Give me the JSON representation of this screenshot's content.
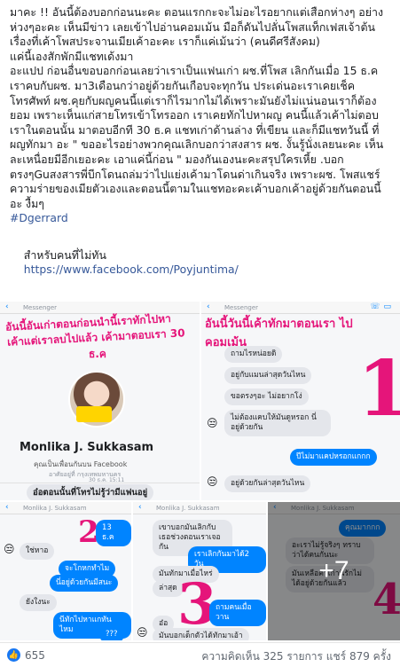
{
  "post": {
    "paragraph1": "มาคะ !! อันนี้ต้องบอกก่อนนะคะ ตอนแรกกะจะไม่อะไรอยากแต่เสือกห่างๆ อย่างห่วงๆอะคะ เห็นมีข่าว เลยเข้าไปอ่านคอมเม้น มือก็ดันไปลั่นโพสแท็กเฟสเจ้าต้นเรื่องที่เค้าโพสประจานเมียเค้าอะคะ เราก็แค่เม้นว่า (คนดีศรีสังคม)",
    "paragraph2": "แค่นี้เองสักพักมีแชทเด้งมา",
    "paragraph3": "อะแปป ก่อนอื่นขอบอกก่อนเลยว่าเราเป็นแฟนเก่า ผช.ที่โพส เลิกกันเมื่อ 15 ธ.ค เราคบกับผช. มา3เดือนกว่าอยู่ด้วยกันเกือบจะทุกวัน ประเด่นอะเราเคยเช็คโทรศัพท์ ผช.คุยกับผญคนนี้แต่เราก็ไรมากไม่ได้เพราะมันยังไม่แน่นอนเราก็ต้องยอม เพราะเห็นแก่สายโทรเข้าโทรออก เราเคยทักไปหาผญ คนนี้แล้วเค้าไม่ตอบเราในตอนนั้น มาตอบอีกที 30 ธ.ค แชทเก่าด้านล่าง ที่เขียน และก็มีแชทวันนี้ ที่ผญทักมา อะ \" ขออะไรอย่างพวกคุณเลิกบอกว่าสงสาร ผช. งั้นรู้นั่งเลยนะคะ เห็นละเหนื่อยมีอีกเยอะคะ เอาแค่นี้ก่อน \" มองกันเองนะคะสรุปใครเหี้ย .บอกตรงๆGuสงสารพี่บีกโดนถล่มว่าไปแย่งเค้ามาโดนด่าเกินจริง เพราะผช. โพสแชร์ความร่ายของเมียตัวเองและตอนนี้ตามในแชทอะคะเค้าบอกเค้าอยู่ด้วยกันตอนนี้ อะ งื้มๆ",
    "hashtag": "#Dgerrard",
    "link_label": "สำหรับคนที่ไม่ทัน",
    "link_url": "https://www.facebook.com/Poyjuntima/"
  },
  "images": {
    "top_left": {
      "header": "Messenger",
      "annotation_line1": "อันนี้อันเก่าตอนก่อนนำนี้เราทักไปหา",
      "annotation_line2": "เค้าแต่เราลบไปแล้ว เค้ามาตอบเรา 30",
      "annotation_line3": "ธ.ค",
      "profile_name": "Monlika J. Sukkasam",
      "profile_sub": "คุณเป็นเพื่อนกันบน Facebook",
      "profile_sub2": "อาศัยอยู่ที่ กรุงเทพมหานคร",
      "time": "30 ธ.ค. 15:11",
      "caption": "อ๋อตอนนั้นที่โทรไม่รู้ว่ามีแฟนอยู่"
    },
    "top_right": {
      "header": "Messenger",
      "annotation": "อันนี้วันนี้เค้าทักมาตอนเรา ไปคอมเม้น",
      "number": "1",
      "msg1": "ถามไรหน่อยดิ",
      "msg2": "อยู่กับแมนล่าสุดวันไหน",
      "msg3": "ขอตรงๆอะ ไม่อยากโง่",
      "msg4": "ไม่ต้องแคบให้มันดูหรอก นี่อยู่ด้วยกัน",
      "reply1": "ปีไม่มาแคปหรอกแกกก",
      "msg5": "อยู่ด้วยกันล่าสุดวันไหน"
    },
    "bottom1": {
      "header": "Monlika J. Sukkasam",
      "number": "2",
      "reply": "13 ธ.ค",
      "msg1": "ใช่หาอ",
      "reply2": "จะโกหกทำไม",
      "reply3": "นี่อยู่ด้วยกันมีสนะ",
      "msg2": "ยังใงนะ",
      "reply4": "นีทักไปหาแกทันไหม",
      "reply5": "???"
    },
    "bottom2": {
      "header": "Monlika J. Sukkasam",
      "number": "3",
      "msg1": "เขาบอกมันเลิกกับเธอช่วงตอนเราเจอกัน",
      "reply1": "เราเลิกกันมาได้2 วัน",
      "msg2": "มันทักมาเมื่อไหร่",
      "msg3": "ล่าสุด",
      "reply2": "ถามคนเมื่อวาน",
      "msg4": "อ๋อ",
      "msg5": "มันบอกเด็กตัวได้ทักมาเอ้า"
    },
    "bottom3": {
      "header": "Monlika J. Sukkasam",
      "number": "4",
      "more_count": "+7",
      "reply1": "คุณมากกก",
      "msg1": "อะเราไม่รู้จริงๆ ทราบว่าได้คนกันนะ",
      "msg2": "มันเหลือคำเก้านี่รักไม่ได้อยู่ด้วยกันแล้ว"
    }
  },
  "footer": {
    "like_count": "655",
    "stats": "ความคิดเห็น 325 รายการ  แชร์ 879 ครั้ง"
  },
  "colors": {
    "link": "#365899",
    "messenger_blue": "#0084ff",
    "annotation_pink": "#e5157a",
    "like_blue": "#1877f2"
  }
}
